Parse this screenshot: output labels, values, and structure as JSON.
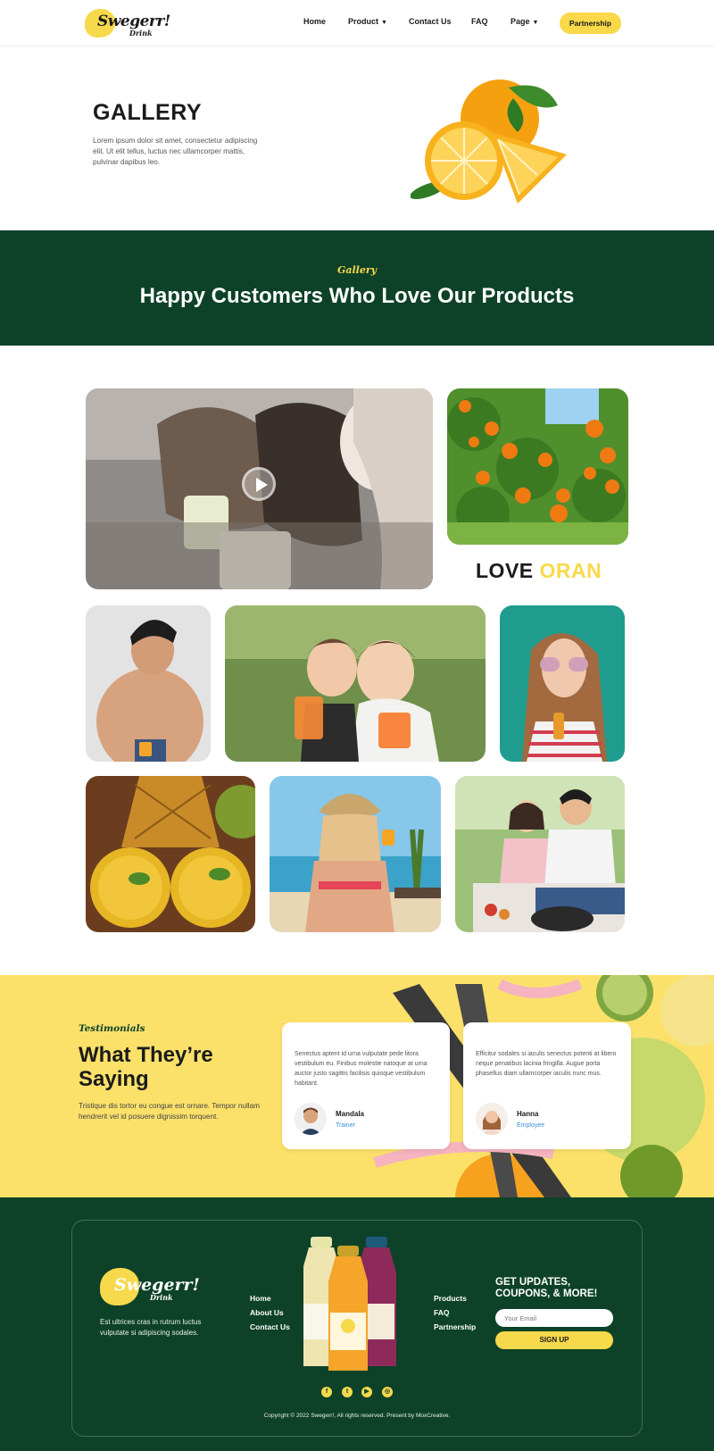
{
  "brand": {
    "name": "Swegerr!",
    "sub": "Drink"
  },
  "nav": {
    "items": [
      "Home",
      "Product",
      "Contact Us",
      "FAQ",
      "Page"
    ],
    "cta": "Partnership"
  },
  "hero": {
    "title": "GALLERY",
    "text": "Lorem ipsum dolor sit amet, consectetur adipiscing elit. Ut elit tellus, luctus nec ullamcorper mattis, pulvinar dapibus leo."
  },
  "band": {
    "tag": "Gallery",
    "title": "Happy Customers Who Love Our Products"
  },
  "gallery": {
    "love_text": "LOVE ",
    "love_highlight": "ORAN",
    "play_icon": "play-icon"
  },
  "testimonials": {
    "tag": "Testimonials",
    "title": "What They’re Saying",
    "text": "Tristique dis tortor eu congue est ornare. Tempor nullam hendrerit vel id posuere dignissim torquent.",
    "cards": [
      {
        "quote": "Senectus aptent id urna vulputate pede litora vestibulum eu. Finibus molestie natoque at urna auctor justo sagittis facilisis quisque vestibulum habitant.",
        "name": "Mandala",
        "role": "Trainer"
      },
      {
        "quote": "Efficitur sodales si iaculis senectus potenti at libero neque penatibus lacinia fringilla. Augue porta phasellus diam ullamcorper iaculis nunc mus.",
        "name": "Hanna",
        "role": "Employee"
      }
    ]
  },
  "footer": {
    "text": "Est ultrices cras in rutrum luctus vulputate si adipiscing sodales.",
    "links_left": [
      "Home",
      "About Us",
      "Contact Us"
    ],
    "links_right": [
      "Products",
      "FAQ",
      "Partnership"
    ],
    "newsletter_title": "GET UPDATES, COUPONS, & MORE!",
    "email_placeholder": "Your Email",
    "signup": "SIGN UP",
    "social_icons": [
      "facebook-icon",
      "twitter-icon",
      "youtube-icon",
      "instagram-icon"
    ],
    "copyright": "Copyright © 2022 Swegerr!, All rights reserved. Present by MoxCreative."
  },
  "colors": {
    "dark_green": "#0d4228",
    "yellow": "#f7d94c",
    "testimonial_bg": "#fbe16a"
  }
}
